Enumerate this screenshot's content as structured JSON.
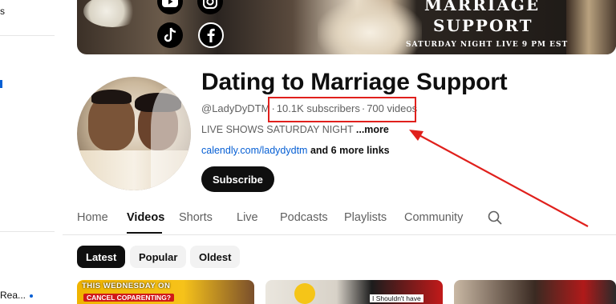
{
  "sidebar": {
    "top_text": "s",
    "bottom_text": "Rea..."
  },
  "banner": {
    "title_line1": "MARRIAGE",
    "title_line2": "SUPPORT",
    "subtitle": "SATURDAY NIGHT LIVE 9 PM EST",
    "social_icons": [
      "youtube-icon",
      "instagram-icon",
      "tiktok-icon",
      "facebook-icon"
    ]
  },
  "channel": {
    "name": "Dating to Marriage Support",
    "handle": "@LadyDyDTM",
    "subscribers": "10.1K subscribers",
    "videos": "700 videos",
    "description": "LIVE SHOWS SATURDAY NIGHT",
    "more_label": "...more",
    "link_text": "calendly.com/ladydydtm",
    "more_links": "and 6 more links",
    "subscribe_label": "Subscribe"
  },
  "tabs": [
    {
      "label": "Home",
      "active": false
    },
    {
      "label": "Videos",
      "active": true
    },
    {
      "label": "Shorts",
      "active": false
    },
    {
      "label": "Live",
      "active": false
    },
    {
      "label": "Podcasts",
      "active": false
    },
    {
      "label": "Playlists",
      "active": false
    },
    {
      "label": "Community",
      "active": false
    }
  ],
  "chips": [
    {
      "label": "Latest",
      "active": true
    },
    {
      "label": "Popular",
      "active": false
    },
    {
      "label": "Oldest",
      "active": false
    }
  ],
  "thumbnails": [
    {
      "text1": "THIS WEDNESDAY ON",
      "text2": "CANCEL COPARENTING?"
    },
    {
      "text1": "I Shouldn't have"
    },
    {
      "text1": ""
    }
  ],
  "colors": {
    "accent": "#065fd4",
    "annotation": "#e0201c",
    "subscribe_bg": "#0f0f0f"
  }
}
